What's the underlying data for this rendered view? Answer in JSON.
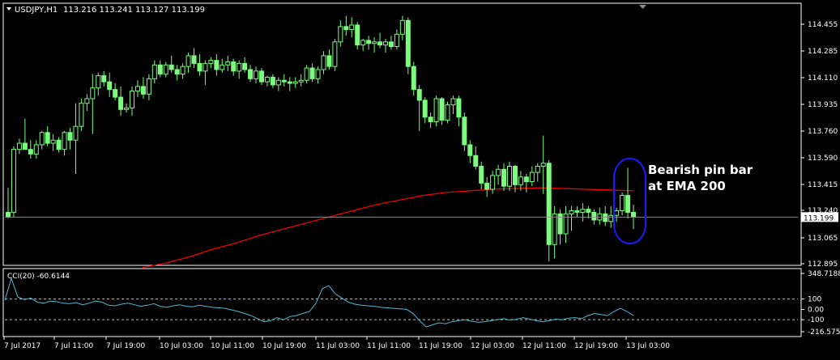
{
  "header": {
    "symbol_label": "USDJPY,H1",
    "ohlc_label": "113.216 113.241 113.127 113.199"
  },
  "annotation": {
    "line1": "Bearish pin bar",
    "line2": "at EMA 200"
  },
  "colors": {
    "background": "#000000",
    "frame": "#ffffff",
    "candle": "#7cfc7c",
    "ema": "#ff0000",
    "cci": "#4fb9d9",
    "highlight": "#1a1aff",
    "price_line": "#8c8c8c",
    "text": "#ffffff"
  },
  "chart_data": [
    {
      "type": "candlestick",
      "symbol": "USDJPY",
      "timeframe": "H1",
      "y_ticks": [
        "114.455",
        "114.285",
        "114.110",
        "113.935",
        "113.760",
        "113.590",
        "113.415",
        "113.240",
        "113.065",
        "112.895"
      ],
      "ylim": [
        112.87,
        114.5
      ],
      "x_ticks": [
        "7 Jul 2017",
        "7 Jul 11:00",
        "7 Jul 19:00",
        "10 Jul 03:00",
        "10 Jul 11:00",
        "10 Jul 19:00",
        "11 Jul 03:00",
        "11 Jul 11:00",
        "11 Jul 19:00",
        "12 Jul 03:00",
        "12 Jul 11:00",
        "12 Jul 19:00",
        "13 Jul 03:00"
      ],
      "current_price": "113.199",
      "candles": [
        [
          113.23,
          113.39,
          113.19,
          113.2
        ],
        [
          113.23,
          113.66,
          113.2,
          113.64
        ],
        [
          113.64,
          113.71,
          113.61,
          113.68
        ],
        [
          113.68,
          113.84,
          113.64,
          113.64
        ],
        [
          113.64,
          113.7,
          113.58,
          113.61
        ],
        [
          113.61,
          113.7,
          113.58,
          113.67
        ],
        [
          113.67,
          113.76,
          113.64,
          113.75
        ],
        [
          113.75,
          113.79,
          113.66,
          113.68
        ],
        [
          113.68,
          113.74,
          113.63,
          113.7
        ],
        [
          113.7,
          113.72,
          113.62,
          113.64
        ],
        [
          113.64,
          113.76,
          113.6,
          113.75
        ],
        [
          113.75,
          113.78,
          113.64,
          113.7
        ],
        [
          113.7,
          113.94,
          113.48,
          113.79
        ],
        [
          113.79,
          113.97,
          113.76,
          113.94
        ],
        [
          113.94,
          114.0,
          113.89,
          113.97
        ],
        [
          113.97,
          114.13,
          113.74,
          114.04
        ],
        [
          114.04,
          114.14,
          113.99,
          114.12
        ],
        [
          114.12,
          114.15,
          114.05,
          114.08
        ],
        [
          114.08,
          114.14,
          113.98,
          114.03
        ],
        [
          114.03,
          114.07,
          113.96,
          113.98
        ],
        [
          113.98,
          114.05,
          113.86,
          113.9
        ],
        [
          113.9,
          113.94,
          113.88,
          113.91
        ],
        [
          113.91,
          114.05,
          113.86,
          114.02
        ],
        [
          114.02,
          114.09,
          113.98,
          114.05
        ],
        [
          114.05,
          114.11,
          113.97,
          114.0
        ],
        [
          114.0,
          114.13,
          113.96,
          114.1
        ],
        [
          114.1,
          114.22,
          114.07,
          114.19
        ],
        [
          114.19,
          114.22,
          114.11,
          114.13
        ],
        [
          114.13,
          114.21,
          114.11,
          114.19
        ],
        [
          114.19,
          114.25,
          114.14,
          114.16
        ],
        [
          114.16,
          114.19,
          114.09,
          114.13
        ],
        [
          114.13,
          114.2,
          114.1,
          114.18
        ],
        [
          114.18,
          114.27,
          114.14,
          114.25
        ],
        [
          114.25,
          114.3,
          114.17,
          114.2
        ],
        [
          114.2,
          114.26,
          114.12,
          114.15
        ],
        [
          114.15,
          114.22,
          114.06,
          114.2
        ],
        [
          114.2,
          114.24,
          114.17,
          114.22
        ],
        [
          114.22,
          114.26,
          114.12,
          114.16
        ],
        [
          114.16,
          114.23,
          114.14,
          114.19
        ],
        [
          114.19,
          114.25,
          114.15,
          114.21
        ],
        [
          114.21,
          114.23,
          114.12,
          114.15
        ],
        [
          114.15,
          114.22,
          114.1,
          114.2
        ],
        [
          114.2,
          114.24,
          114.14,
          114.16
        ],
        [
          114.16,
          114.19,
          114.08,
          114.1
        ],
        [
          114.1,
          114.18,
          114.07,
          114.15
        ],
        [
          114.15,
          114.17,
          114.06,
          114.08
        ],
        [
          114.08,
          114.12,
          114.05,
          114.11
        ],
        [
          114.11,
          114.13,
          114.04,
          114.06
        ],
        [
          114.06,
          114.11,
          114.02,
          114.09
        ],
        [
          114.09,
          114.13,
          114.05,
          114.08
        ],
        [
          114.08,
          114.11,
          114.02,
          114.07
        ],
        [
          114.07,
          114.11,
          114.04,
          114.08
        ],
        [
          114.08,
          114.13,
          114.05,
          114.09
        ],
        [
          114.09,
          114.19,
          114.07,
          114.17
        ],
        [
          114.17,
          114.2,
          114.08,
          114.1
        ],
        [
          114.1,
          114.18,
          114.07,
          114.16
        ],
        [
          114.16,
          114.28,
          114.13,
          114.25
        ],
        [
          114.25,
          114.29,
          114.16,
          114.18
        ],
        [
          114.18,
          114.36,
          114.15,
          114.34
        ],
        [
          114.34,
          114.48,
          114.31,
          114.44
        ],
        [
          114.44,
          114.51,
          114.38,
          114.42
        ],
        [
          114.42,
          114.5,
          114.37,
          114.45
        ],
        [
          114.45,
          114.47,
          114.29,
          114.32
        ],
        [
          114.32,
          114.36,
          114.28,
          114.35
        ],
        [
          114.35,
          114.38,
          114.29,
          114.33
        ],
        [
          114.33,
          114.37,
          114.27,
          114.34
        ],
        [
          114.34,
          114.4,
          114.3,
          114.32
        ],
        [
          114.32,
          114.36,
          114.27,
          114.34
        ],
        [
          114.34,
          114.38,
          114.29,
          114.31
        ],
        [
          114.31,
          114.42,
          114.29,
          114.39
        ],
        [
          114.39,
          114.51,
          114.35,
          114.48
        ],
        [
          114.48,
          114.5,
          114.13,
          114.18
        ],
        [
          114.18,
          114.21,
          113.99,
          114.03
        ],
        [
          114.03,
          114.06,
          113.76,
          113.96
        ],
        [
          113.96,
          113.98,
          113.81,
          113.85
        ],
        [
          113.85,
          113.88,
          113.78,
          113.82
        ],
        [
          113.82,
          113.99,
          113.79,
          113.97
        ],
        [
          113.97,
          113.98,
          113.8,
          113.83
        ],
        [
          113.83,
          113.95,
          113.81,
          113.93
        ],
        [
          113.93,
          113.99,
          113.87,
          113.97
        ],
        [
          113.97,
          113.99,
          113.79,
          113.85
        ],
        [
          113.85,
          113.88,
          113.63,
          113.67
        ],
        [
          113.67,
          113.7,
          113.55,
          113.6
        ],
        [
          113.6,
          113.66,
          113.51,
          113.53
        ],
        [
          113.53,
          113.56,
          113.38,
          113.42
        ],
        [
          113.42,
          113.46,
          113.33,
          113.38
        ],
        [
          113.38,
          113.5,
          113.35,
          113.47
        ],
        [
          113.47,
          113.54,
          113.41,
          113.51
        ],
        [
          113.51,
          113.55,
          113.37,
          113.4
        ],
        [
          113.4,
          113.56,
          113.37,
          113.53
        ],
        [
          113.53,
          113.54,
          113.36,
          113.41
        ],
        [
          113.41,
          113.5,
          113.37,
          113.46
        ],
        [
          113.46,
          113.48,
          113.36,
          113.43
        ],
        [
          113.43,
          113.53,
          113.4,
          113.49
        ],
        [
          113.49,
          113.55,
          113.43,
          113.53
        ],
        [
          113.53,
          113.73,
          113.35,
          113.55
        ],
        [
          113.55,
          113.57,
          112.91,
          113.02
        ],
        [
          113.02,
          113.27,
          112.93,
          113.22
        ],
        [
          113.22,
          113.25,
          113.02,
          113.09
        ],
        [
          113.09,
          113.27,
          113.03,
          113.22
        ],
        [
          113.22,
          113.27,
          113.11,
          113.24
        ],
        [
          113.24,
          113.27,
          113.2,
          113.23
        ],
        [
          113.23,
          113.29,
          113.17,
          113.25
        ],
        [
          113.25,
          113.27,
          113.19,
          113.23
        ],
        [
          113.23,
          113.25,
          113.15,
          113.18
        ],
        [
          113.18,
          113.26,
          113.15,
          113.22
        ],
        [
          113.22,
          113.27,
          113.14,
          113.17
        ],
        [
          113.17,
          113.27,
          113.13,
          113.21
        ],
        [
          113.21,
          113.26,
          113.17,
          113.24
        ],
        [
          113.24,
          113.36,
          113.21,
          113.34
        ],
        [
          113.34,
          113.52,
          113.19,
          113.23
        ],
        [
          113.23,
          113.28,
          113.12,
          113.2
        ]
      ],
      "ema_200": [
        112.87,
        112.9,
        112.94,
        112.99,
        113.03,
        113.08,
        113.12,
        113.16,
        113.2,
        113.24,
        113.28,
        113.31,
        113.34,
        113.36,
        113.37,
        113.38,
        113.385,
        113.39,
        113.385,
        113.38,
        113.375,
        113.37
      ],
      "highlight": {
        "from_candle": 110,
        "to_candle": 111,
        "label": "Bearish pin bar at EMA 200"
      }
    },
    {
      "type": "line",
      "indicator_label": "CCI(20) -60.6144",
      "y_ticks": [
        "348.7188",
        "100",
        "0.00",
        "-100",
        "-216.5755"
      ],
      "ylim": [
        -216.5755,
        348.7188
      ],
      "levels": [
        100,
        -100
      ],
      "values": [
        90,
        300,
        120,
        95,
        110,
        70,
        60,
        80,
        75,
        60,
        55,
        65,
        45,
        60,
        80,
        70,
        40,
        35,
        50,
        60,
        45,
        30,
        40,
        55,
        30,
        20,
        35,
        45,
        30,
        25,
        40,
        30,
        20,
        15,
        10,
        -5,
        -20,
        -40,
        -60,
        -90,
        -120,
        -110,
        -80,
        -100,
        -70,
        -60,
        -40,
        -20,
        60,
        200,
        230,
        150,
        110,
        70,
        50,
        40,
        35,
        30,
        20,
        15,
        10,
        5,
        0,
        -40,
        -110,
        -170,
        -150,
        -130,
        -140,
        -120,
        -110,
        -100,
        -115,
        -125,
        -120,
        -110,
        -100,
        -90,
        -105,
        -95,
        -80,
        -95,
        -110,
        -120,
        -110,
        -95,
        -100,
        -85,
        -80,
        -90,
        -60,
        -40,
        -50,
        -60,
        -20,
        10,
        -20,
        -60.6144
      ]
    }
  ]
}
